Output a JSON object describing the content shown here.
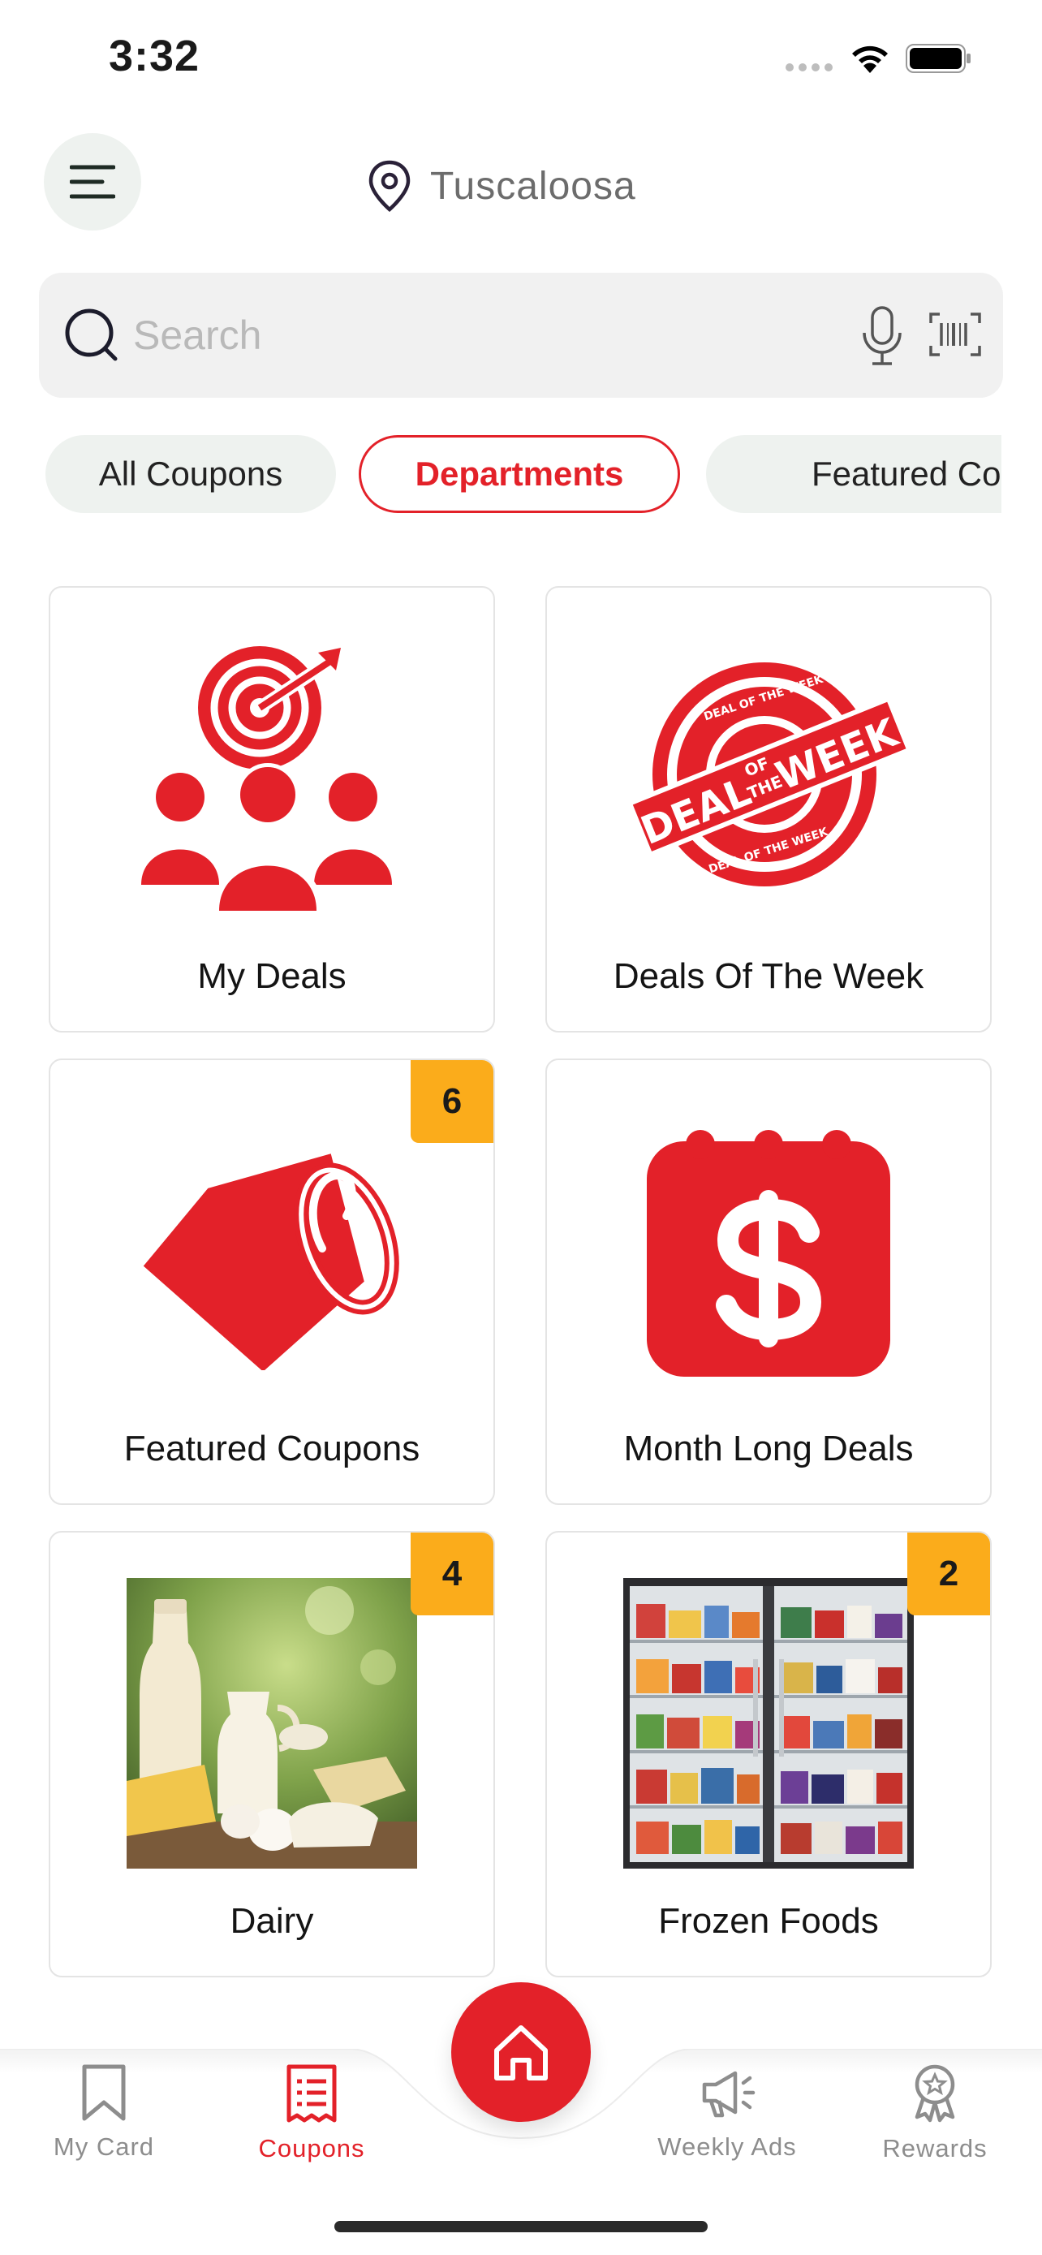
{
  "status_bar": {
    "time": "3:32"
  },
  "header": {
    "location": "Tuscaloosa"
  },
  "search": {
    "placeholder": "Search"
  },
  "tabs": [
    {
      "label": "All Coupons",
      "active": false
    },
    {
      "label": "Departments",
      "active": true
    },
    {
      "label": "Featured Coupons",
      "active": false
    }
  ],
  "departments": [
    {
      "label": "My Deals",
      "icon": "target-people-icon",
      "badge": null
    },
    {
      "label": "Deals Of The Week",
      "icon": "deal-of-the-week-stamp",
      "badge": null,
      "stamp_text": [
        "DEAL OF THE WEEK",
        "DEAL",
        "OF",
        "THE",
        "WEEK"
      ]
    },
    {
      "label": "Featured Coupons",
      "icon": "price-tag-icon",
      "badge": "6"
    },
    {
      "label": "Month Long Deals",
      "icon": "calendar-dollar-icon",
      "badge": null
    },
    {
      "label": "Dairy",
      "icon": "dairy-photo",
      "badge": "4"
    },
    {
      "label": "Frozen Foods",
      "icon": "frozen-foods-photo",
      "badge": "2"
    }
  ],
  "bottom_nav": [
    {
      "label": "My Card",
      "icon": "bookmark-icon",
      "active": false
    },
    {
      "label": "Coupons",
      "icon": "coupon-list-icon",
      "active": true
    },
    {
      "label": "Weekly Ads",
      "icon": "megaphone-icon",
      "active": false
    },
    {
      "label": "Rewards",
      "icon": "award-ribbon-icon",
      "active": false
    }
  ],
  "colors": {
    "accent": "#e32129",
    "badge": "#fbac1b",
    "chip": "#eef2ef",
    "search_bg": "#f1f1f1"
  }
}
